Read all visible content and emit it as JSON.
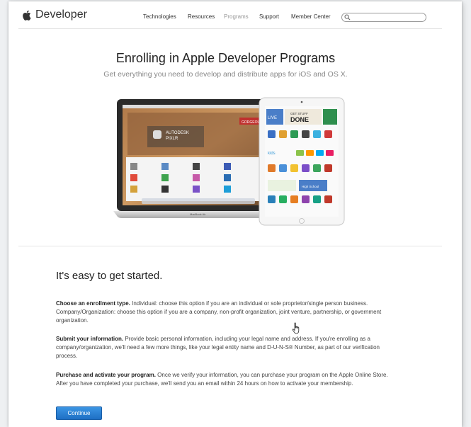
{
  "nav": {
    "logo_text": "Developer",
    "links": [
      "Technologies",
      "Resources",
      "Programs",
      "Support",
      "Member Center"
    ],
    "active_link": "Programs",
    "search_placeholder": ""
  },
  "hero": {
    "title": "Enrolling in Apple Developer Programs",
    "subtitle": "Get everything you need to develop and distribute apps for iOS and OS X."
  },
  "devices": {
    "laptop_app_title": "AUTODESK\nPIXLR",
    "laptop_badge": "GORGEOUS",
    "laptop_label": "MacBook Air",
    "tablet_banner_top": "GET STUFF",
    "tablet_banner": "DONE",
    "tablet_live": "LIVE",
    "tablet_kids": "kids",
    "tablet_school": "High School"
  },
  "steps": {
    "title": "It's easy to get started.",
    "items": [
      {
        "heading": "Choose an enrollment type.",
        "text": " Individual: choose this option if you are an individual or sole proprietor/single person business. Company/Organization: choose this option if you are a company, non-profit organization, joint venture, partnership, or government organization."
      },
      {
        "heading": "Submit your information.",
        "text": " Provide basic personal information, including your legal name and address. If you're enrolling as a company/organization, we'll need a few more things, like your legal entity name and D-U-N-S® Number, as part of our verification process."
      },
      {
        "heading": "Purchase and activate your program.",
        "text": " Once we verify your information, you can purchase your program on the Apple Online Store. After you have completed your purchase, we'll send you an email within 24 hours on how to activate your membership."
      }
    ],
    "button_label": "Continue"
  },
  "colors": {
    "button": "#2a7fd3",
    "link": "#333333",
    "active_link": "#999999"
  }
}
